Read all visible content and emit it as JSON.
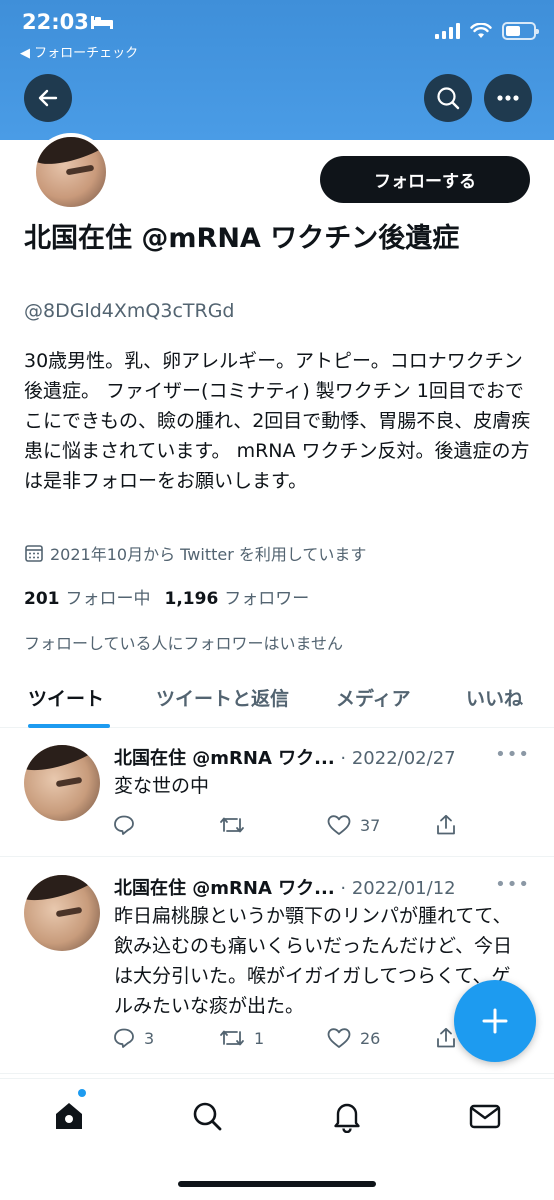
{
  "status_bar": {
    "time": "22:03",
    "back_app": "◀ フォローチェック"
  },
  "profile": {
    "follow_button": "フォローする",
    "display_name": "北国在住 @mRNA ワクチン後遺症",
    "handle": "@8DGld4XmQ3cTRGd",
    "bio": "30歳男性。乳、卵アレルギー。アトピー。コロナワクチン後遺症。 ファイザー(コミナティ) 製ワクチン 1回目でおでこにできもの、瞼の腫れ、2回目で動悸、胃腸不良、皮膚疾患に悩まされています。 mRNA ワクチン反対。後遺症の方は是非フォローをお願いします。",
    "joined": "2021年10月から Twitter を利用しています",
    "following_count": "201",
    "following_label": "フォロー中",
    "followers_count": "1,196",
    "followers_label": "フォロワー",
    "followed_by": "フォローしている人にフォロワーはいません"
  },
  "tabs": [
    {
      "label": "ツイート",
      "active": true
    },
    {
      "label": "ツイートと返信",
      "active": false
    },
    {
      "label": "メディア",
      "active": false
    },
    {
      "label": "いいね",
      "active": false
    }
  ],
  "tweets": [
    {
      "name": "北国在住 @mRNA ワク...",
      "date": "· 2022/02/27",
      "more": "•••",
      "text": "変な世の中",
      "replies": "",
      "retweets": "",
      "likes": "37"
    },
    {
      "name": "北国在住 @mRNA ワク...",
      "date": "· 2022/01/12",
      "more": "•••",
      "text": "昨日扁桃腺というか顎下のリンパが腫れてて、飲み込むのも痛いくらいだったんだけど、今日は大分引いた。喉がイガイガしてつらくて、ゲルみたいな痰が出た。",
      "replies": "3",
      "retweets": "1",
      "likes": "26"
    }
  ],
  "colors": {
    "banner": "#4a9ce6",
    "accent": "#1d9bf0",
    "text": "#0f1419",
    "muted": "#536471"
  },
  "icons": [
    "back-arrow-icon",
    "search-icon",
    "more-icon",
    "calendar-icon",
    "reply-icon",
    "retweet-icon",
    "like-icon",
    "share-icon",
    "compose-plus-icon",
    "home-icon",
    "explore-icon",
    "notifications-icon",
    "messages-icon"
  ]
}
